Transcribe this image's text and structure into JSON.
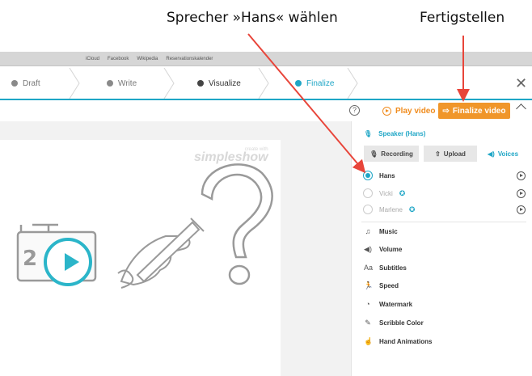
{
  "annotations": {
    "speaker": "Sprecher »Hans« wählen",
    "finalize": "Fertigstellen"
  },
  "bookmarks": [
    "iCloud",
    "Facebook",
    "Wikipedia",
    "Reservationskalender"
  ],
  "steps": [
    {
      "label": "Draft"
    },
    {
      "label": "Write"
    },
    {
      "label": "Visualize"
    },
    {
      "label": "Finalize"
    }
  ],
  "toolbar": {
    "help": "?",
    "play_video": "Play video",
    "finalize_video": "Finalize video"
  },
  "canvas": {
    "logo": "simpleshow",
    "logo_small": "create with"
  },
  "panel": {
    "speaker_title": "Speaker (Hans)",
    "tabs": [
      "Recording",
      "Upload",
      "Voices"
    ],
    "voices": [
      {
        "name": "Hans",
        "selected": true,
        "badge": false
      },
      {
        "name": "Vicki",
        "selected": false,
        "badge": true
      },
      {
        "name": "Marlene",
        "selected": false,
        "badge": true
      }
    ],
    "sections": [
      "Music",
      "Volume",
      "Subtitles",
      "Speed",
      "Watermark",
      "Scribble Color",
      "Hand Animations"
    ]
  },
  "colors": {
    "accent": "#1fa6c6",
    "orange": "#f0962a",
    "arrow": "#e8453a"
  }
}
